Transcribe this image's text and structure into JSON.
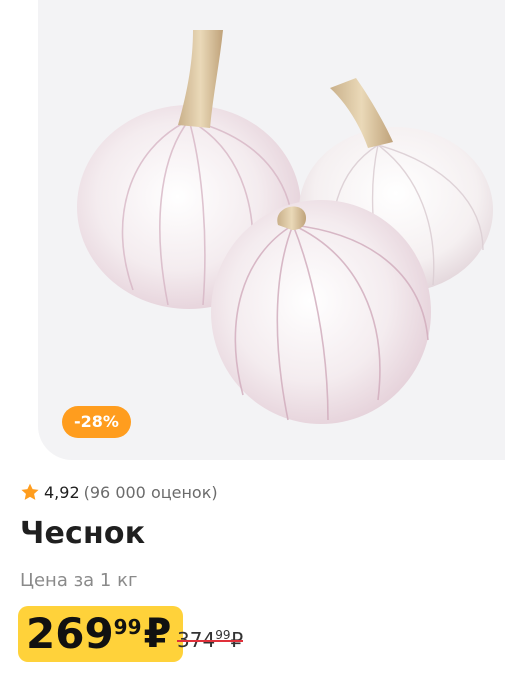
{
  "product": {
    "discount_badge": "-28%",
    "rating": {
      "value": "4,92",
      "count_text": "(96 000 оценок)"
    },
    "title": "Чеснок",
    "unit_caption": "Цена за 1 кг",
    "price": {
      "rubles": "269",
      "kopecks": "99",
      "currency": "₽"
    },
    "old_price": {
      "rubles": "374",
      "kopecks": "99",
      "currency": "₽"
    }
  },
  "icons": {
    "star": "star-icon"
  },
  "colors": {
    "badge_bg": "#ff9d1e",
    "price_bg": "#ffd23a",
    "strike": "#e0303a",
    "star": "#ff9d1e"
  }
}
